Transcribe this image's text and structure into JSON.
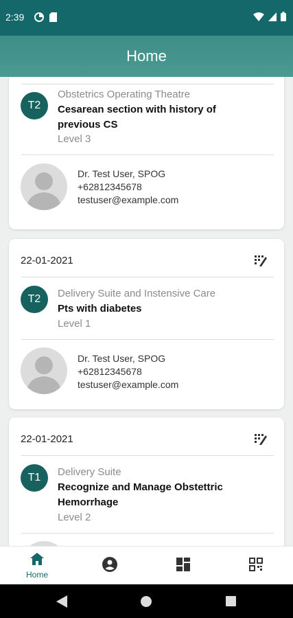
{
  "status": {
    "time": "2:39"
  },
  "header": {
    "title": "Home"
  },
  "cards": [
    {
      "badge": "T2",
      "department": "Obstetrics Operating Theatre",
      "title_line1": "Cesarean section with history of",
      "title_line2": "previous CS",
      "level": "Level 3",
      "doctor": {
        "name": "Dr. Test User, SPOG",
        "phone": "+62812345678",
        "email": "testuser@example.com"
      }
    },
    {
      "date": "22-01-2021",
      "badge": "T2",
      "department": "Delivery Suite and Instensive Care",
      "title_line1": "Pts with diabetes",
      "level": "Level 1",
      "doctor": {
        "name": "Dr. Test User, SPOG",
        "phone": "+62812345678",
        "email": "testuser@example.com"
      }
    },
    {
      "date": "22-01-2021",
      "badge": "T1",
      "department": "Delivery Suite",
      "title_line1": "Recognize and Manage Obstettric",
      "title_line2": "Hemorrhage",
      "level": "Level 2"
    }
  ],
  "bottom_nav": [
    {
      "label": "Home",
      "icon": "home-icon",
      "active": true
    },
    {
      "icon": "account-circle-icon"
    },
    {
      "icon": "dashboard-icon"
    },
    {
      "icon": "qr-code-icon"
    }
  ],
  "colors": {
    "primary": "#15686a",
    "header": "#4a9a92",
    "badge": "#17625f"
  }
}
